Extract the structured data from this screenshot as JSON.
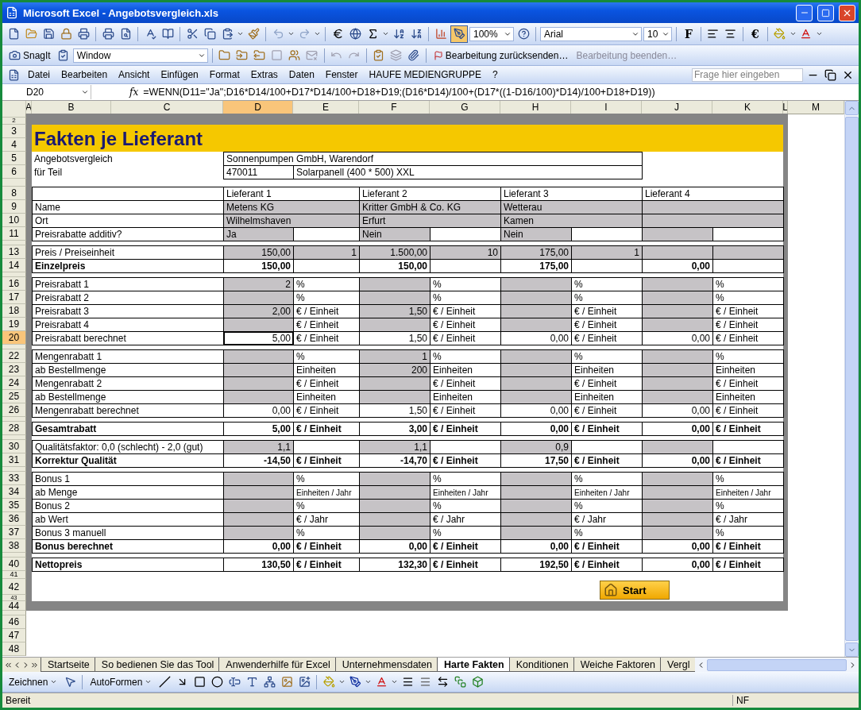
{
  "window": {
    "title": "Microsoft Excel - Angebotsvergleich.xls"
  },
  "toolbar": {
    "zoom": "100%",
    "font": "Arial",
    "font_size": "10",
    "bold": "F",
    "currency": "€"
  },
  "snagit_toolbar": {
    "label": "SnagIt",
    "capture_mode": "Window",
    "actions": [
      {
        "label": "Bearbeitung zurücksenden…",
        "disabled": false
      },
      {
        "label": "Bearbeitung beenden…",
        "disabled": true
      }
    ]
  },
  "menu": {
    "items": [
      "Datei",
      "Bearbeiten",
      "Ansicht",
      "Einfügen",
      "Format",
      "Extras",
      "Daten",
      "Fenster",
      "HAUFE MEDIENGRUPPE",
      "?"
    ],
    "help_placeholder": "Frage hier eingeben"
  },
  "formula_bar": {
    "name_box": "D20",
    "function_label": "fx",
    "formula": "=WENN(D11=\"Ja\";D16*D14/100+D17*D14/100+D18+D19;(D16*D14)/100+(D17*((1-D16/100)*D14)/100+D18+D19))"
  },
  "sheet": {
    "columns": [
      {
        "label": "A",
        "selected": false
      },
      {
        "label": "B",
        "selected": false
      },
      {
        "label": "C",
        "selected": false
      },
      {
        "label": "D",
        "selected": true
      },
      {
        "label": "E",
        "selected": false
      },
      {
        "label": "F",
        "selected": false
      },
      {
        "label": "G",
        "selected": false
      },
      {
        "label": "H",
        "selected": false
      },
      {
        "label": "I",
        "selected": false
      },
      {
        "label": "J",
        "selected": false
      },
      {
        "label": "K",
        "selected": false
      },
      {
        "label": "L",
        "selected": false
      },
      {
        "label": "M",
        "selected": false
      }
    ],
    "rows": [
      {
        "kind": "frame",
        "selected": false
      },
      {
        "header": "2",
        "kind": "frame",
        "selected": false
      },
      {
        "header": "3",
        "kind": "title",
        "selected": false,
        "text": "Fakten je Lieferant"
      },
      {
        "header": "4",
        "kind": "continued",
        "selected": false
      },
      {
        "header": "5",
        "kind": "info",
        "selected": false,
        "label": "Angebotsvergleich",
        "fields": [
          "Sonnenpumpen GmbH, Warendorf"
        ]
      },
      {
        "header": "6",
        "kind": "info",
        "selected": false,
        "label": "für Teil",
        "fields": [
          "470011",
          "Solarpanell (400 * 500) XXL"
        ]
      },
      {
        "kind": "blank",
        "selected": false
      },
      {
        "header": "8",
        "kind": "suppliers",
        "selected": false,
        "cells": [
          "Lieferant 1",
          "Lieferant 2",
          "Lieferant 3",
          "Lieferant 4"
        ]
      },
      {
        "header": "9",
        "kind": "span",
        "selected": false,
        "label": "Name",
        "cells": [
          {
            "value": "Metens KG",
            "shaded": true
          },
          {
            "value": "Kritter GmbH & Co. KG",
            "shaded": true
          },
          {
            "value": "Wetterau",
            "shaded": true
          },
          {
            "shaded": true
          }
        ]
      },
      {
        "header": "10",
        "kind": "span",
        "selected": false,
        "label": "Ort",
        "cells": [
          {
            "value": "Wilhelmshaven",
            "shaded": true
          },
          {
            "value": "Erfurt",
            "shaded": true
          },
          {
            "value": "Kamen",
            "shaded": true
          },
          {
            "shaded": true
          }
        ]
      },
      {
        "header": "11",
        "kind": "choice",
        "selected": false,
        "label": "Preisrabatte additiv?",
        "bold": false,
        "cells": [
          {
            "value": "Ja",
            "shaded": true
          },
          {
            "value": "Nein",
            "shaded": true
          },
          {
            "value": "Nein",
            "shaded": true
          },
          {
            "shaded": true
          }
        ]
      },
      {
        "kind": "gap",
        "selected": false
      },
      {
        "header": "13",
        "kind": "price",
        "selected": false,
        "label": "Preis / Preiseinheit",
        "bold": false,
        "cells": [
          {
            "value": "150,00",
            "unit": "1",
            "shaded": true
          },
          {
            "value": "1.500,00",
            "unit": "10",
            "shaded": true
          },
          {
            "value": "175,00",
            "unit": "1",
            "shaded": true
          },
          {
            "shaded": true
          }
        ]
      },
      {
        "header": "14",
        "kind": "pair",
        "selected": false,
        "label": "Einzelpreis",
        "bold": true,
        "cells": [
          {
            "value": "150,00",
            "shaded": false
          },
          {
            "value": "150,00",
            "shaded": false
          },
          {
            "value": "175,00",
            "shaded": false
          },
          {
            "value": "0,00",
            "shaded": false
          }
        ]
      },
      {
        "kind": "gap",
        "selected": false
      },
      {
        "header": "16",
        "kind": "pair",
        "selected": false,
        "label": "Preisrabatt 1",
        "bold": false,
        "cells": [
          {
            "value": "2",
            "unit": "%",
            "shaded": true
          },
          {
            "unit": "%",
            "shaded": true
          },
          {
            "unit": "%",
            "shaded": true
          },
          {
            "unit": "%",
            "shaded": true
          }
        ]
      },
      {
        "header": "17",
        "kind": "pair",
        "selected": false,
        "label": "Preisrabatt 2",
        "bold": false,
        "cells": [
          {
            "unit": "%",
            "shaded": true
          },
          {
            "unit": "%",
            "shaded": true
          },
          {
            "unit": "%",
            "shaded": true
          },
          {
            "unit": "%",
            "shaded": true
          }
        ]
      },
      {
        "header": "18",
        "kind": "pair",
        "selected": false,
        "label": "Preisrabatt 3",
        "bold": false,
        "cells": [
          {
            "value": "2,00",
            "unit": "€ / Einheit",
            "shaded": true
          },
          {
            "value": "1,50",
            "unit": "€ / Einheit",
            "shaded": true
          },
          {
            "unit": "€ / Einheit",
            "shaded": true
          },
          {
            "unit": "€ / Einheit",
            "shaded": true
          }
        ]
      },
      {
        "header": "19",
        "kind": "pair",
        "selected": false,
        "label": "Preisrabatt 4",
        "bold": false,
        "cells": [
          {
            "unit": "€ / Einheit",
            "shaded": true
          },
          {
            "unit": "€ / Einheit",
            "shaded": true
          },
          {
            "unit": "€ / Einheit",
            "shaded": true
          },
          {
            "unit": "€ / Einheit",
            "shaded": true
          }
        ]
      },
      {
        "header": "20",
        "kind": "pair",
        "selected": true,
        "label": "Preisrabatt berechnet",
        "bold": false,
        "cells": [
          {
            "value": "5,00",
            "unit": "€ / Einheit",
            "shaded": false
          },
          {
            "value": "1,50",
            "unit": "€ / Einheit",
            "shaded": false
          },
          {
            "value": "0,00",
            "unit": "€ / Einheit",
            "shaded": false
          },
          {
            "value": "0,00",
            "unit": "€ / Einheit",
            "shaded": false
          }
        ]
      },
      {
        "kind": "gap",
        "selected": false
      },
      {
        "header": "22",
        "kind": "pair",
        "selected": false,
        "label": "Mengenrabatt 1",
        "bold": false,
        "cells": [
          {
            "unit": "%",
            "shaded": true
          },
          {
            "value": "1",
            "unit": "%",
            "shaded": true
          },
          {
            "unit": "%",
            "shaded": true
          },
          {
            "unit": "%",
            "shaded": true
          }
        ]
      },
      {
        "header": "23",
        "kind": "pair",
        "selected": false,
        "label": "ab Bestellmenge",
        "bold": false,
        "cells": [
          {
            "unit": "Einheiten",
            "shaded": true
          },
          {
            "value": "200",
            "unit": "Einheiten",
            "shaded": true
          },
          {
            "unit": "Einheiten",
            "shaded": true
          },
          {
            "unit": "Einheiten",
            "shaded": true
          }
        ]
      },
      {
        "header": "24",
        "kind": "pair",
        "selected": false,
        "label": "Mengenrabatt 2",
        "bold": false,
        "cells": [
          {
            "unit": "€ / Einheit",
            "shaded": true
          },
          {
            "unit": "€ / Einheit",
            "shaded": true
          },
          {
            "unit": "€ / Einheit",
            "shaded": true
          },
          {
            "unit": "€ / Einheit",
            "shaded": true
          }
        ]
      },
      {
        "header": "25",
        "kind": "pair",
        "selected": false,
        "label": "ab Bestellmenge",
        "bold": false,
        "cells": [
          {
            "unit": "Einheiten",
            "shaded": true
          },
          {
            "unit": "Einheiten",
            "shaded": true
          },
          {
            "unit": "Einheiten",
            "shaded": true
          },
          {
            "unit": "Einheiten",
            "shaded": true
          }
        ]
      },
      {
        "header": "26",
        "kind": "pair",
        "selected": false,
        "label": "Mengenrabatt berechnet",
        "bold": false,
        "cells": [
          {
            "value": "0,00",
            "unit": "€ / Einheit",
            "shaded": false
          },
          {
            "value": "1,50",
            "unit": "€ / Einheit",
            "shaded": false
          },
          {
            "value": "0,00",
            "unit": "€ / Einheit",
            "shaded": false
          },
          {
            "value": "0,00",
            "unit": "€ / Einheit",
            "shaded": false
          }
        ]
      },
      {
        "kind": "gap",
        "selected": false
      },
      {
        "header": "28",
        "kind": "pair",
        "selected": false,
        "label": "Gesamtrabatt",
        "bold": true,
        "cells": [
          {
            "value": "5,00",
            "unit": "€ / Einheit",
            "shaded": false
          },
          {
            "value": "3,00",
            "unit": "€ / Einheit",
            "shaded": false
          },
          {
            "value": "0,00",
            "unit": "€ / Einheit",
            "shaded": false
          },
          {
            "value": "0,00",
            "unit": "€ / Einheit",
            "shaded": false
          }
        ]
      },
      {
        "kind": "gap",
        "selected": false
      },
      {
        "header": "30",
        "kind": "pair",
        "selected": false,
        "label": "Qualitätsfaktor: 0,0 (schlecht) - 2,0 (gut)",
        "bold": false,
        "cells": [
          {
            "value": "1,1",
            "shaded": true
          },
          {
            "value": "1,1",
            "shaded": true
          },
          {
            "value": "0,9",
            "shaded": true
          },
          {
            "shaded": true
          }
        ]
      },
      {
        "header": "31",
        "kind": "pair",
        "selected": false,
        "label": "Korrektur  Qualität",
        "bold": true,
        "cells": [
          {
            "value": "-14,50",
            "unit": "€ / Einheit",
            "shaded": false
          },
          {
            "value": "-14,70",
            "unit": "€ / Einheit",
            "shaded": false
          },
          {
            "value": "17,50",
            "unit": "€ / Einheit",
            "shaded": false
          },
          {
            "value": "0,00",
            "unit": "€ / Einheit",
            "shaded": false
          }
        ]
      },
      {
        "kind": "gap",
        "selected": false
      },
      {
        "header": "33",
        "kind": "pair",
        "selected": false,
        "label": "Bonus 1",
        "bold": false,
        "cells": [
          {
            "unit": "%",
            "shaded": true
          },
          {
            "unit": "%",
            "shaded": true
          },
          {
            "unit": "%",
            "shaded": true
          },
          {
            "unit": "%",
            "shaded": true
          }
        ]
      },
      {
        "header": "34",
        "kind": "pair",
        "selected": false,
        "label": "ab Menge",
        "bold": false,
        "small_units": true,
        "cells": [
          {
            "unit": "Einheiten / Jahr",
            "shaded": true
          },
          {
            "unit": "Einheiten / Jahr",
            "shaded": true
          },
          {
            "unit": "Einheiten / Jahr",
            "shaded": true
          },
          {
            "unit": "Einheiten / Jahr",
            "shaded": true
          }
        ]
      },
      {
        "header": "35",
        "kind": "pair",
        "selected": false,
        "label": "Bonus 2",
        "bold": false,
        "cells": [
          {
            "unit": "%",
            "shaded": true
          },
          {
            "unit": "%",
            "shaded": true
          },
          {
            "unit": "%",
            "shaded": true
          },
          {
            "unit": "%",
            "shaded": true
          }
        ]
      },
      {
        "header": "36",
        "kind": "pair",
        "selected": false,
        "label": "ab Wert",
        "bold": false,
        "cells": [
          {
            "unit": "€ / Jahr",
            "shaded": true
          },
          {
            "unit": "€ / Jahr",
            "shaded": true
          },
          {
            "unit": "€ / Jahr",
            "shaded": true
          },
          {
            "unit": "€ / Jahr",
            "shaded": true
          }
        ]
      },
      {
        "header": "37",
        "kind": "pair",
        "selected": false,
        "label": "Bonus 3 manuell",
        "bold": false,
        "cells": [
          {
            "unit": "%",
            "shaded": true
          },
          {
            "unit": "%",
            "shaded": true
          },
          {
            "unit": "%",
            "shaded": true
          },
          {
            "unit": "%",
            "shaded": true
          }
        ]
      },
      {
        "header": "38",
        "kind": "pair",
        "selected": false,
        "label": "Bonus berechnet",
        "bold": true,
        "cells": [
          {
            "value": "0,00",
            "unit": "€ / Einheit",
            "shaded": false
          },
          {
            "value": "0,00",
            "unit": "€ / Einheit",
            "shaded": false
          },
          {
            "value": "0,00",
            "unit": "€ / Einheit",
            "shaded": false
          },
          {
            "value": "0,00",
            "unit": "€ / Einheit",
            "shaded": false
          }
        ]
      },
      {
        "kind": "gap",
        "selected": false
      },
      {
        "header": "40",
        "kind": "pair",
        "selected": false,
        "label": "Nettopreis",
        "bold": true,
        "cells": [
          {
            "value": "130,50",
            "unit": "€ / Einheit",
            "shaded": false
          },
          {
            "value": "132,30",
            "unit": "€ / Einheit",
            "shaded": false
          },
          {
            "value": "192,50",
            "unit": "€ / Einheit",
            "shaded": false
          },
          {
            "value": "0,00",
            "unit": "€ / Einheit",
            "shaded": false
          }
        ]
      },
      {
        "header": "41",
        "kind": "blank",
        "selected": false
      },
      {
        "header": "42",
        "kind": "button",
        "selected": false,
        "button": "Start"
      },
      {
        "header": "43",
        "kind": "blank",
        "selected": false
      },
      {
        "header": "44",
        "kind": "frame",
        "selected": false
      },
      {
        "kind": "outside",
        "selected": false
      },
      {
        "header": "46",
        "kind": "outside",
        "selected": false
      },
      {
        "header": "47",
        "kind": "outside",
        "selected": false
      },
      {
        "header": "48",
        "kind": "outside",
        "selected": false
      }
    ]
  },
  "sheet_tabs": [
    {
      "label": "Startseite",
      "selected": false
    },
    {
      "label": "So bedienen Sie das Tool",
      "selected": false
    },
    {
      "label": "Anwenderhilfe für Excel",
      "selected": false
    },
    {
      "label": "Unternehmensdaten",
      "selected": false
    },
    {
      "label": "Harte Fakten",
      "selected": true
    },
    {
      "label": "Konditionen",
      "selected": false
    },
    {
      "label": "Weiche Faktoren",
      "selected": false
    },
    {
      "label": "Vergl",
      "selected": false
    }
  ],
  "drawing_toolbar": {
    "draw": "Zeichnen",
    "autoshapes": "AutoFormen"
  },
  "status_bar": {
    "text": "Bereit",
    "indicator": "NF"
  }
}
